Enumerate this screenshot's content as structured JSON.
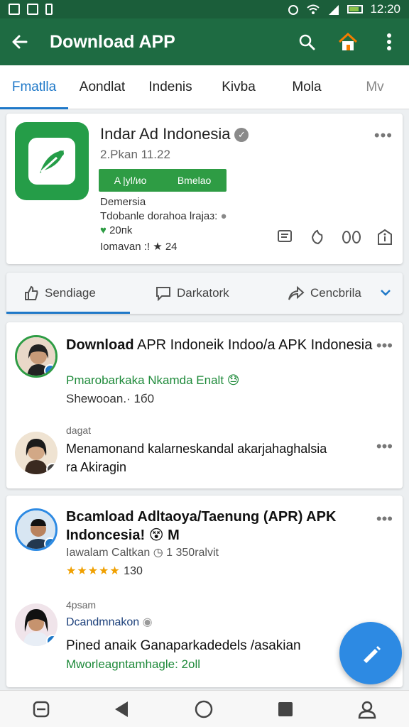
{
  "status_bar": {
    "time": "12:20"
  },
  "app_bar": {
    "title": "Download APP"
  },
  "tabs": [
    {
      "label": "Fmatlla",
      "active": true
    },
    {
      "label": "Aondlat",
      "active": false
    },
    {
      "label": "Indenis",
      "active": false
    },
    {
      "label": "Kivba",
      "active": false
    },
    {
      "label": "Mola",
      "active": false
    },
    {
      "label": "Mv",
      "active": false
    }
  ],
  "app": {
    "name": "Indar Ad Indonesia",
    "version": "2.Pkan 11.22",
    "install_left": "A |yl/иo",
    "install_right": "Bmelao",
    "developer": "Demersia",
    "description": "Tdobanle dorahoa lrajaз:",
    "size": "20пk",
    "rating": "Iomavan :! ★ 24"
  },
  "action_bar": {
    "items": [
      {
        "label": "Sendiage"
      },
      {
        "label": "Darkatork"
      },
      {
        "label": "Cencbrila"
      }
    ]
  },
  "posts": [
    {
      "title_bold": "Download",
      "title_rest": " APR Indoneik Indoo/a APK Indonesia",
      "subtitle": "Pmarobarkaka Nkamda Enalt 😓",
      "meta": "Shewooan.· 1б0"
    },
    {
      "title": "Menamonand kalarneskandal akarjahaghalsia",
      "title2": "ra Akiragin",
      "meta": "dagat"
    },
    {
      "title_line1": "Bcamload Adltaoya/Taenung (APR) APK",
      "title_line2": "Indoncesia! 😵 M",
      "meta": "Iawalam Caltkan",
      "meta2": "1 350ralvit",
      "stars": "★★★★★",
      "rating_count": "130"
    },
    {
      "small_label": "4psam",
      "name": "Dcandmnakon",
      "text": "Pined anaik Ganaparkadedels /asakian",
      "subtext": "Mworleagntamhagle: 2oll"
    }
  ],
  "colors": {
    "app_bar": "#1e6b42",
    "status_bar": "#1b5e3a",
    "accent": "#1e78c8",
    "install_green": "#2e9c44",
    "fab": "#2d8ae3"
  }
}
